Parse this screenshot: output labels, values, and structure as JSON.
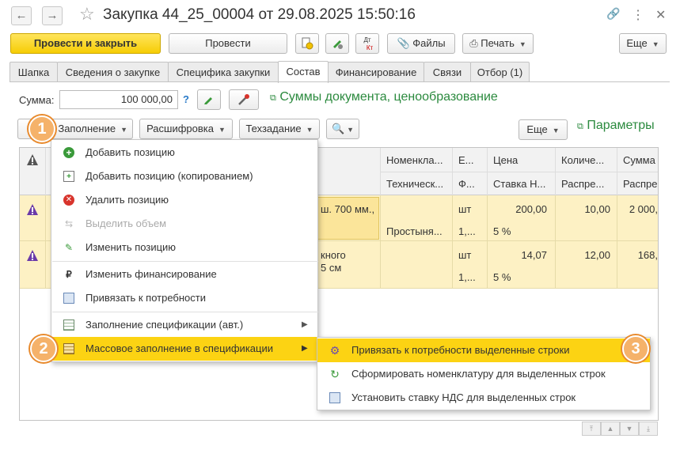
{
  "window": {
    "title": "Закупка 44_25_00004 от 29.08.2025 15:50:16",
    "back_glyph": "←",
    "forward_glyph": "→",
    "star_glyph": "☆",
    "link_glyph": "🔗",
    "more_glyph": "⋮",
    "close_glyph": "✕"
  },
  "toolbar": {
    "post_close": "Провести и закрыть",
    "post": "Провести",
    "files": "Файлы",
    "print": "Печать",
    "more": "Еще",
    "dt_label": "Дт",
    "kt_label": "Кт"
  },
  "tabs": [
    {
      "label": "Шапка"
    },
    {
      "label": "Сведения о закупке"
    },
    {
      "label": "Специфика закупки"
    },
    {
      "label": "Состав"
    },
    {
      "label": "Финансирование"
    },
    {
      "label": "Связи"
    },
    {
      "label": "Отбор (1)"
    }
  ],
  "sum": {
    "label": "Сумма:",
    "value": "100 000,00",
    "help": "?",
    "link": "Суммы документа, ценообразование"
  },
  "subtoolbar": {
    "fill": "Заполнение",
    "decode": "Расшифровка",
    "spec": "Техзадание",
    "more": "Еще",
    "params": "Параметры"
  },
  "table": {
    "headers_top": [
      "Номенкла...",
      "Е...",
      "Цена",
      "Количе...",
      "Сумма"
    ],
    "headers_bottom": [
      "Техническ...",
      "Ф...",
      "Ставка Н...",
      "Распре...",
      "Распре"
    ],
    "rows": [
      {
        "desc1": "ш. 700 мм.,",
        "nom2": "Простыня...",
        "unit": "шт",
        "unit2": "1,...",
        "price": "200,00",
        "vat": "5 %",
        "qty": "10,00",
        "sum": "2 000,"
      },
      {
        "desc1": "кного",
        "desc2": "5 см",
        "unit": "шт",
        "unit2": "1,...",
        "price": "14,07",
        "vat": "5 %",
        "qty": "12,00",
        "sum": "168,"
      }
    ]
  },
  "menu": {
    "items": [
      {
        "label": "Добавить позицию",
        "icon": "add-circle-icon"
      },
      {
        "label": "Добавить позицию (копированием)",
        "icon": "copy-add-icon"
      },
      {
        "label": "Удалить позицию",
        "icon": "delete-circle-icon"
      },
      {
        "label": "Выделить объем",
        "icon": "split-icon"
      },
      {
        "label": "Изменить позицию",
        "icon": "pencil-icon"
      },
      {
        "label": "Изменить финансирование",
        "icon": "ruble-icon"
      },
      {
        "label": "Привязать к потребности",
        "icon": "link-need-icon"
      },
      {
        "label": "Заполнение спецификации (авт.)",
        "icon": "table-auto-icon"
      },
      {
        "label": "Массовое заполнение в спецификации",
        "icon": "table-mass-icon"
      }
    ]
  },
  "submenu": {
    "items": [
      {
        "label": "Привязать к потребности выделенные строки",
        "icon": "gear-link-icon"
      },
      {
        "label": "Сформировать номенклатуру для выделенных строк",
        "icon": "refresh-icon"
      },
      {
        "label": "Установить ставку НДС для выделенных строк",
        "icon": "vat-icon"
      }
    ]
  },
  "badges": [
    "1",
    "2",
    "3"
  ],
  "colors": {
    "primary_button": "#f6cd05",
    "selected_row": "#fdf1c4",
    "menu_highlight": "#fcd313",
    "link_green": "#2b8a3e",
    "badge_orange": "#f5b26a"
  }
}
